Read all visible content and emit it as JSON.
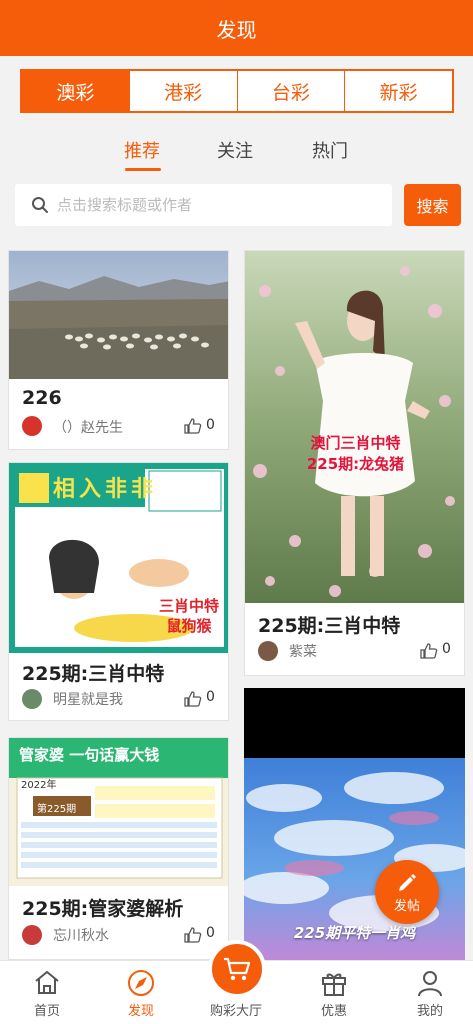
{
  "header": {
    "title": "发现"
  },
  "lottery_tabs": [
    {
      "label": "澳彩",
      "active": true
    },
    {
      "label": "港彩",
      "active": false
    },
    {
      "label": "台彩",
      "active": false
    },
    {
      "label": "新彩",
      "active": false
    }
  ],
  "sub_tabs": [
    {
      "label": "推荐",
      "active": true
    },
    {
      "label": "关注",
      "active": false
    },
    {
      "label": "热门",
      "active": false
    }
  ],
  "search": {
    "placeholder": "点击搜索标题或作者",
    "button_label": "搜索"
  },
  "posts": [
    {
      "title": "226",
      "author": "（）赵先生",
      "likes": "0",
      "image": "landscape-sheep"
    },
    {
      "title": "225期:三肖中特",
      "author": "紫菜",
      "likes": "0",
      "image": "woman-in-flowers",
      "overlay": [
        "澳门三肖中特",
        "225期:龙兔猪"
      ]
    },
    {
      "title": "225期:三肖中特",
      "author": "明星就是我",
      "likes": "0",
      "image": "cartoon-ad",
      "overlay": [
        "三肖中特",
        "鼠狗猴"
      ],
      "banner": "相入非非"
    },
    {
      "title": "",
      "author": "",
      "likes": "",
      "image": "sky-clouds",
      "overlay": [
        "225期平特一肖鸡"
      ]
    },
    {
      "title": "225期:管家婆解析",
      "author": "忘川秋水",
      "likes": "0",
      "image": "guanjiapo-poster",
      "banner": "管家婆 一句话赢大钱",
      "year": "2022年",
      "issue": "第225期"
    }
  ],
  "fab": {
    "label": "发帖",
    "icon": "pencil-icon"
  },
  "nav": [
    {
      "label": "首页",
      "icon": "home-icon",
      "active": false
    },
    {
      "label": "发现",
      "icon": "discover-icon",
      "active": true
    },
    {
      "label": "购彩大厅",
      "icon": "cart-icon",
      "active": false
    },
    {
      "label": "优惠",
      "icon": "gift-icon",
      "active": false
    },
    {
      "label": "我的",
      "icon": "user-icon",
      "active": false
    }
  ],
  "colors": {
    "accent": "#f55d0a",
    "background": "#f2f2f2"
  }
}
